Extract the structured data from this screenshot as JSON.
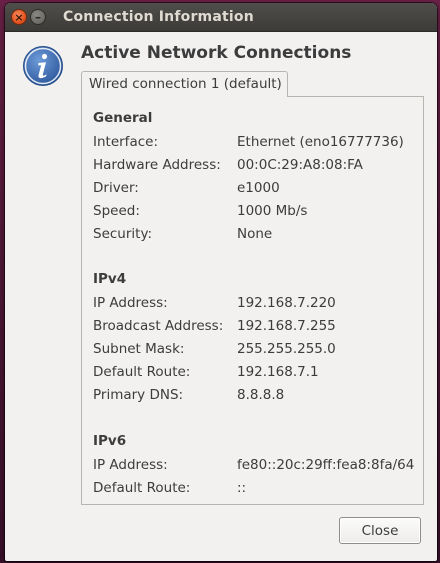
{
  "window": {
    "title": "Connection Information"
  },
  "dialog": {
    "heading": "Active Network Connections",
    "tab_label": "Wired connection 1 (default)",
    "close_label": "Close"
  },
  "sections": {
    "general": {
      "title": "General",
      "rows": [
        {
          "label": "Interface:",
          "value": "Ethernet (eno16777736)"
        },
        {
          "label": "Hardware Address:",
          "value": "00:0C:29:A8:08:FA"
        },
        {
          "label": "Driver:",
          "value": "e1000"
        },
        {
          "label": "Speed:",
          "value": "1000 Mb/s"
        },
        {
          "label": "Security:",
          "value": "None"
        }
      ]
    },
    "ipv4": {
      "title": "IPv4",
      "rows": [
        {
          "label": "IP Address:",
          "value": "192.168.7.220"
        },
        {
          "label": "Broadcast Address:",
          "value": "192.168.7.255"
        },
        {
          "label": "Subnet Mask:",
          "value": "255.255.255.0"
        },
        {
          "label": "Default Route:",
          "value": "192.168.7.1"
        },
        {
          "label": "Primary DNS:",
          "value": "8.8.8.8"
        }
      ]
    },
    "ipv6": {
      "title": "IPv6",
      "rows": [
        {
          "label": "IP Address:",
          "value": "fe80::20c:29ff:fea8:8fa/64"
        },
        {
          "label": "Default Route:",
          "value": "::"
        }
      ]
    }
  },
  "icons": {
    "close": "close-icon",
    "minimize": "minimize-icon",
    "info": "info-icon"
  },
  "colors": {
    "info_icon": "#3f6fb5",
    "close_button": "#e2541f",
    "titlebar": "#3c3b37"
  }
}
